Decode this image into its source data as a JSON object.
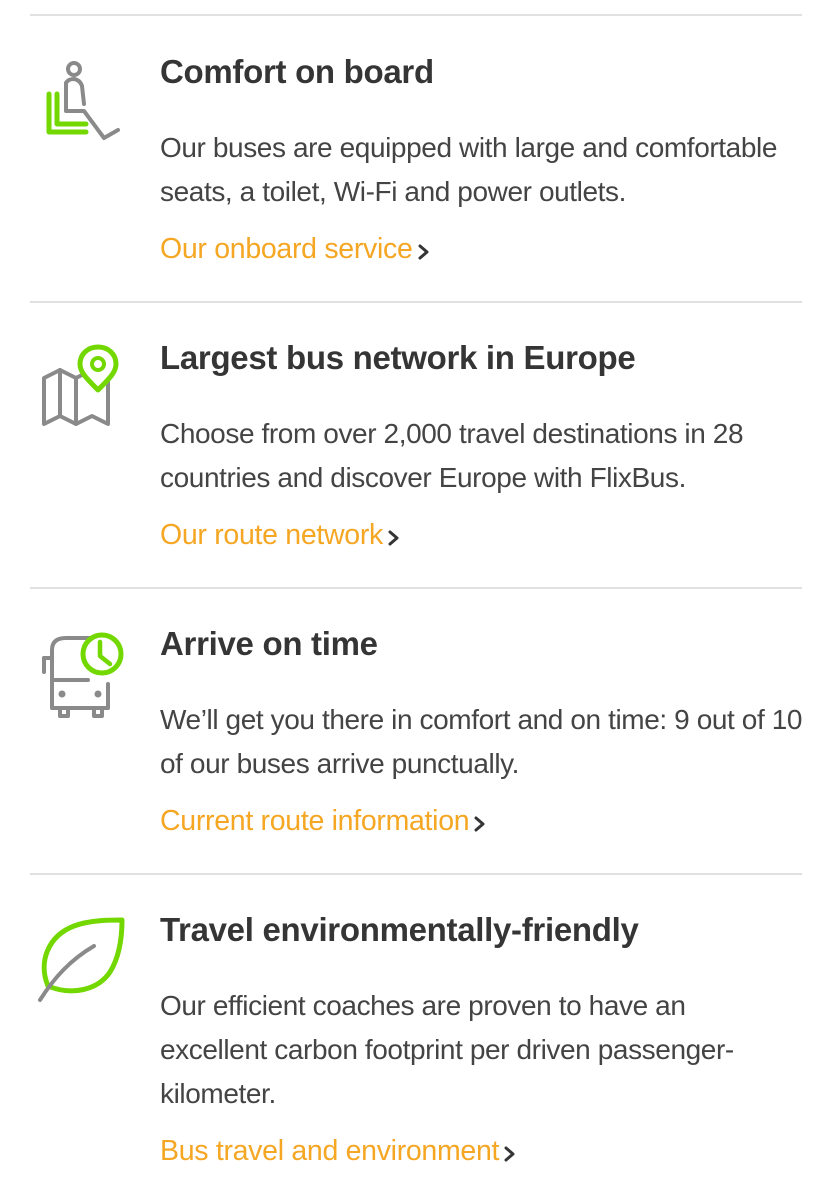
{
  "colors": {
    "accent_green": "#73d700",
    "icon_gray": "#8a8a8a",
    "link_orange": "#f5a623",
    "title": "#353535",
    "text": "#444444",
    "divider": "#e1e1e1"
  },
  "features": [
    {
      "icon": "seat-icon",
      "title": "Comfort on board",
      "description": "Our buses are equipped with large and comfortable seats, a toilet, Wi-Fi and power outlets.",
      "link": "Our onboard service"
    },
    {
      "icon": "map-pin-icon",
      "title": "Largest bus network in Europe",
      "description": "Choose from over 2,000 travel destinations in 28 countries and discover Europe with FlixBus.",
      "link": "Our route network"
    },
    {
      "icon": "bus-clock-icon",
      "title": "Arrive on time",
      "description": "We’ll get you there in comfort and on time: 9 out of 10 of our buses arrive punctually.",
      "link": "Current route information"
    },
    {
      "icon": "leaf-icon",
      "title": "Travel environmentally-friendly",
      "description": "Our efficient coaches are proven to have an excellent carbon footprint per driven passenger-kilometer.",
      "link": "Bus travel and environment"
    }
  ]
}
